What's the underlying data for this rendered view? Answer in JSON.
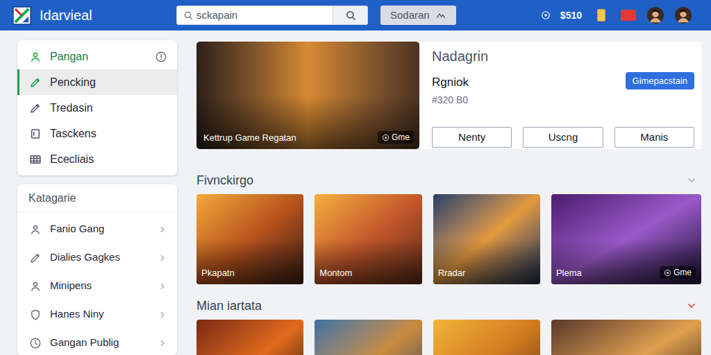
{
  "header": {
    "logo": "Idarvieal",
    "search": {
      "placeholder": "sckapain"
    },
    "button": "Sodaran",
    "balance": "$510"
  },
  "sidebar": {
    "nav": [
      {
        "label": "Pangan",
        "selected": false,
        "color": "#15803d"
      },
      {
        "label": "Pencking",
        "selected": true,
        "color": "#1f2937"
      },
      {
        "label": "Tredasin",
        "selected": false,
        "color": "#1f2937"
      },
      {
        "label": "Tasckens",
        "selected": false,
        "color": "#1f2937"
      },
      {
        "label": "Ececliais",
        "selected": false,
        "color": "#1f2937"
      }
    ],
    "categories": {
      "title": "Katagarie",
      "items": [
        "Fanio Gang",
        "Dialies Gagkes",
        "Minipens",
        "Hanes Niny",
        "Gangan Publig"
      ]
    }
  },
  "featured": {
    "caption": "Kettrup Game Regatan",
    "badge": "Gme",
    "title": "Nadagrin",
    "name": "Rgniok",
    "meta": "#320 B0",
    "primary_button": "Gimepacstain",
    "buttons": [
      "Nenty",
      "Uscng",
      "Manis"
    ]
  },
  "sections": [
    {
      "title": "Fivnckirgo",
      "color": "#9ca3af",
      "cards": [
        {
          "caption": "Pkapatn",
          "badge": null
        },
        {
          "caption": "Montom",
          "badge": null
        },
        {
          "caption": "Rradar",
          "badge": null
        },
        {
          "caption": "Plema",
          "badge": "Gme"
        }
      ]
    },
    {
      "title": "Mian iartata",
      "color": "#dc2626",
      "cards": [
        {
          "caption": null,
          "badge": null
        },
        {
          "caption": null,
          "badge": null
        },
        {
          "caption": null,
          "badge": null
        },
        {
          "caption": null,
          "badge": null
        }
      ]
    }
  ]
}
